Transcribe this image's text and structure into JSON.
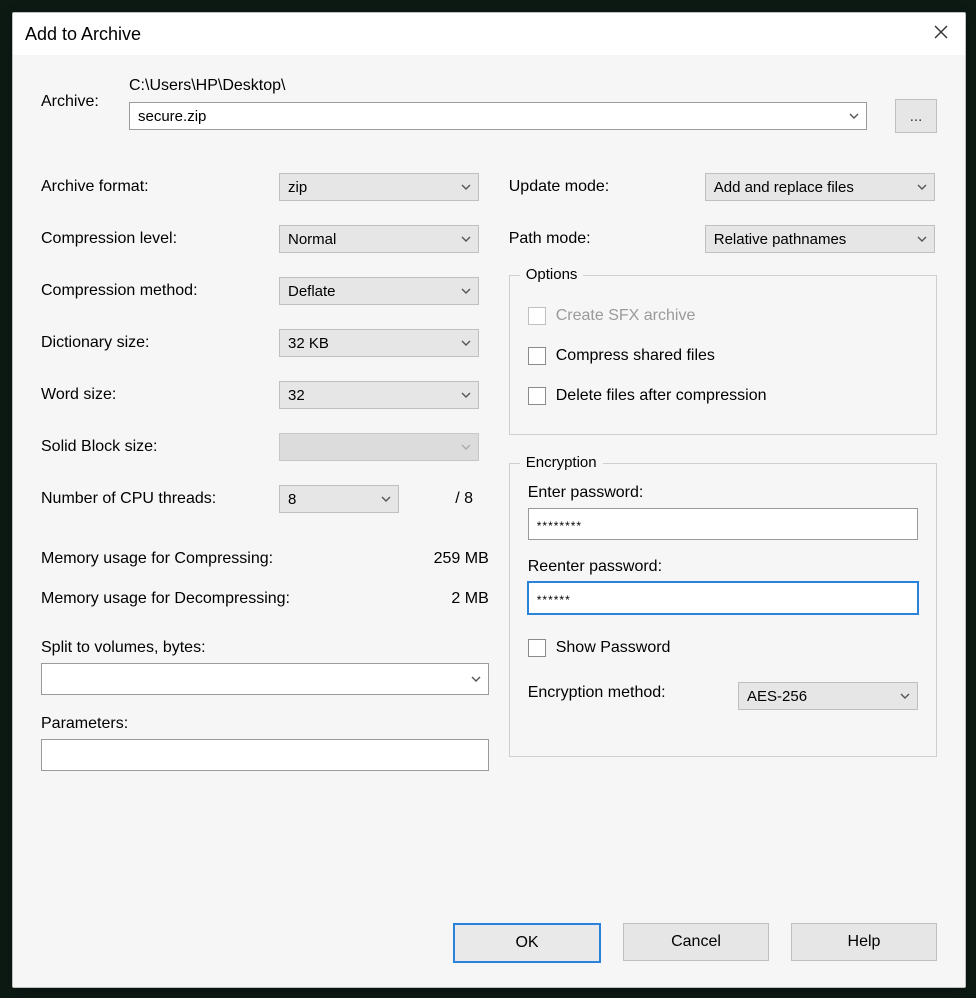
{
  "title": "Add to Archive",
  "archive": {
    "label": "Archive:",
    "path": "C:\\Users\\HP\\Desktop\\",
    "filename": "secure.zip",
    "browse": "..."
  },
  "left": {
    "format": {
      "label": "Archive format:",
      "value": "zip"
    },
    "level": {
      "label": "Compression level:",
      "value": "Normal"
    },
    "method": {
      "label": "Compression method:",
      "value": "Deflate"
    },
    "dict": {
      "label": "Dictionary size:",
      "value": "32 KB"
    },
    "word": {
      "label": "Word size:",
      "value": "32"
    },
    "block": {
      "label": "Solid Block size:",
      "value": ""
    },
    "threads": {
      "label": "Number of CPU threads:",
      "value": "8",
      "of": "/ 8"
    },
    "mem_comp": {
      "label": "Memory usage for Compressing:",
      "value": "259 MB"
    },
    "mem_decomp": {
      "label": "Memory usage for Decompressing:",
      "value": "2 MB"
    },
    "split": {
      "label": "Split to volumes, bytes:",
      "value": ""
    },
    "params": {
      "label": "Parameters:",
      "value": ""
    }
  },
  "right": {
    "update": {
      "label": "Update mode:",
      "value": "Add and replace files"
    },
    "path": {
      "label": "Path mode:",
      "value": "Relative pathnames"
    },
    "options": {
      "legend": "Options",
      "sfx": "Create SFX archive",
      "shared": "Compress shared files",
      "delete": "Delete files after compression"
    },
    "encryption": {
      "legend": "Encryption",
      "enter": "Enter password:",
      "reenter": "Reenter password:",
      "pw1": "********",
      "pw2": "******",
      "show": "Show Password",
      "method": {
        "label": "Encryption method:",
        "value": "AES-256"
      }
    }
  },
  "buttons": {
    "ok": "OK",
    "cancel": "Cancel",
    "help": "Help"
  }
}
